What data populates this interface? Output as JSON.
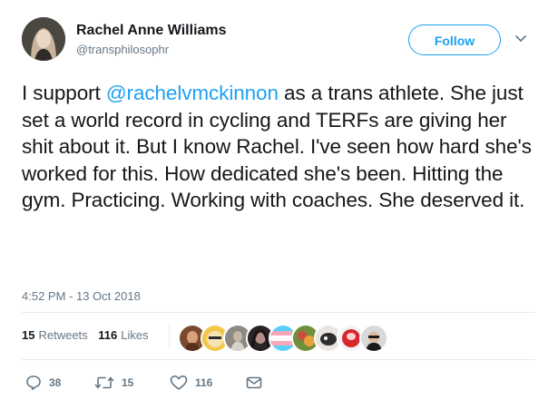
{
  "author": {
    "name": "Rachel Anne Williams",
    "handle": "@transphilosophr",
    "avatar_icon": "profile-photo"
  },
  "header": {
    "follow_label": "Follow",
    "menu_icon": "chevron-down-icon"
  },
  "tweet": {
    "text_before": "I support ",
    "mention": "@rachelvmckinnon",
    "text_after": " as a trans athlete. She just set a world record in cycling and TERFs are giving her shit about it. But I know Rachel. I've seen how hard she's worked for this. How dedicated she's been. Hitting the gym. Practicing. Working with coaches. She deserved it.",
    "timestamp": "4:52 PM - 13 Oct 2018"
  },
  "stats": {
    "retweets_count": "15",
    "retweets_label": "Retweets",
    "likes_count": "116",
    "likes_label": "Likes",
    "liker_avatars": [
      "liker-avatar-1",
      "liker-avatar-2",
      "liker-avatar-3",
      "liker-avatar-4",
      "liker-avatar-5",
      "liker-avatar-6",
      "liker-avatar-7",
      "liker-avatar-8",
      "liker-avatar-9"
    ]
  },
  "actions": {
    "reply_count": "38",
    "retweet_count": "15",
    "like_count": "116",
    "reply_icon": "reply-icon",
    "retweet_icon": "retweet-icon",
    "like_icon": "heart-icon",
    "dm_icon": "envelope-icon"
  },
  "colors": {
    "accent": "#1da1f2",
    "text": "#14171a",
    "secondary": "#657786",
    "divider": "#e6ecf0"
  }
}
